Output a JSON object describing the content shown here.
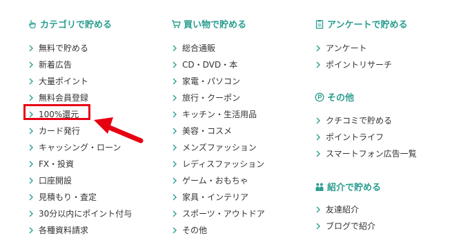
{
  "columns": [
    {
      "heading": {
        "label": "カテゴリで貯める",
        "icon": "hand-pointer-icon"
      },
      "items": [
        "無料で貯める",
        "新着広告",
        "大量ポイント",
        "無料会員登録",
        "100%還元",
        "カード発行",
        "キャッシング・ローン",
        "FX・投資",
        "口座開設",
        "見積もり・査定",
        "30分以内にポイント付与",
        "各種資料請求"
      ]
    },
    {
      "heading": {
        "label": "買い物で貯める",
        "icon": "shopping-cart-icon"
      },
      "items": [
        "総合通販",
        "CD・DVD・本",
        "家電・パソコン",
        "旅行・クーポン",
        "キッチン・生活用品",
        "美容・コスメ",
        "メンズファッション",
        "レディスファッション",
        "ゲーム・おもちゃ",
        "家具・インテリア",
        "スポーツ・アウトドア",
        "その他"
      ]
    },
    {
      "sections": [
        {
          "heading": {
            "label": "アンケートで貯める",
            "icon": "clipboard-icon"
          },
          "items": [
            "アンケート",
            "ポイントリサーチ"
          ]
        },
        {
          "heading": {
            "label": "その他",
            "icon": "point-circle-icon"
          },
          "items": [
            "クチコミで貯める",
            "ポイントライフ",
            "スマートフォン広告一覧"
          ]
        },
        {
          "heading": {
            "label": "紹介で貯める",
            "icon": "people-icon"
          },
          "items": [
            "友達紹介",
            "ブログで紹介"
          ]
        }
      ]
    }
  ],
  "annotation": {
    "highlighted_item": "100%還元",
    "highlight_color": "#e60012"
  },
  "colors": {
    "heading": "#2a9d8f",
    "chevron": "#2a9d8f",
    "text": "#333333"
  }
}
